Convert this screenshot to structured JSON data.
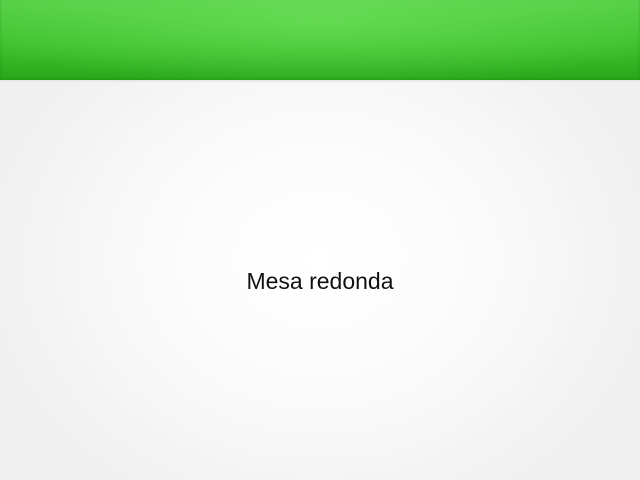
{
  "slide": {
    "title": "Mesa redonda"
  },
  "colors": {
    "header_band": "#3fc22f",
    "background": "#ffffff",
    "text": "#111111"
  }
}
